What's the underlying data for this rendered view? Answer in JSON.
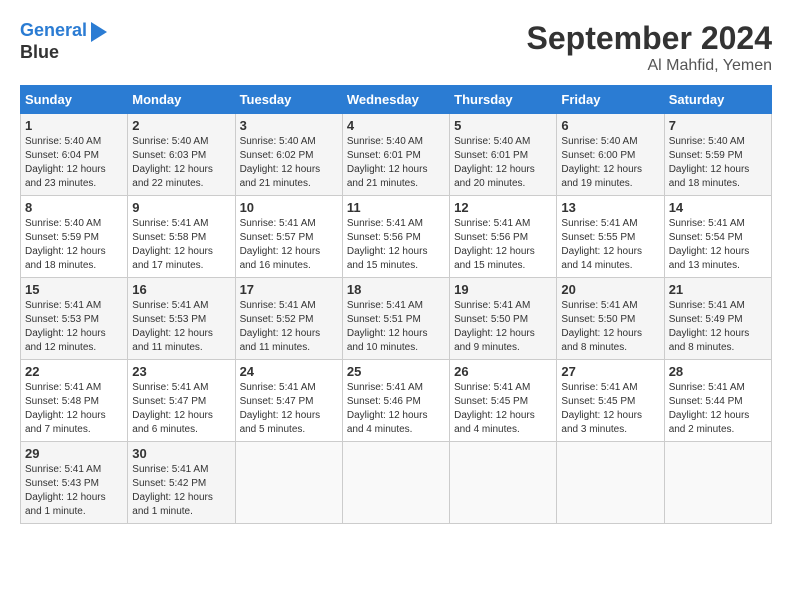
{
  "header": {
    "logo_line1": "General",
    "logo_line2": "Blue",
    "month": "September 2024",
    "location": "Al Mahfid, Yemen"
  },
  "weekdays": [
    "Sunday",
    "Monday",
    "Tuesday",
    "Wednesday",
    "Thursday",
    "Friday",
    "Saturday"
  ],
  "weeks": [
    [
      {
        "day": "1",
        "sunrise": "5:40 AM",
        "sunset": "6:04 PM",
        "daylight": "12 hours and 23 minutes."
      },
      {
        "day": "2",
        "sunrise": "5:40 AM",
        "sunset": "6:03 PM",
        "daylight": "12 hours and 22 minutes."
      },
      {
        "day": "3",
        "sunrise": "5:40 AM",
        "sunset": "6:02 PM",
        "daylight": "12 hours and 21 minutes."
      },
      {
        "day": "4",
        "sunrise": "5:40 AM",
        "sunset": "6:01 PM",
        "daylight": "12 hours and 21 minutes."
      },
      {
        "day": "5",
        "sunrise": "5:40 AM",
        "sunset": "6:01 PM",
        "daylight": "12 hours and 20 minutes."
      },
      {
        "day": "6",
        "sunrise": "5:40 AM",
        "sunset": "6:00 PM",
        "daylight": "12 hours and 19 minutes."
      },
      {
        "day": "7",
        "sunrise": "5:40 AM",
        "sunset": "5:59 PM",
        "daylight": "12 hours and 18 minutes."
      }
    ],
    [
      {
        "day": "8",
        "sunrise": "5:40 AM",
        "sunset": "5:59 PM",
        "daylight": "12 hours and 18 minutes."
      },
      {
        "day": "9",
        "sunrise": "5:41 AM",
        "sunset": "5:58 PM",
        "daylight": "12 hours and 17 minutes."
      },
      {
        "day": "10",
        "sunrise": "5:41 AM",
        "sunset": "5:57 PM",
        "daylight": "12 hours and 16 minutes."
      },
      {
        "day": "11",
        "sunrise": "5:41 AM",
        "sunset": "5:56 PM",
        "daylight": "12 hours and 15 minutes."
      },
      {
        "day": "12",
        "sunrise": "5:41 AM",
        "sunset": "5:56 PM",
        "daylight": "12 hours and 15 minutes."
      },
      {
        "day": "13",
        "sunrise": "5:41 AM",
        "sunset": "5:55 PM",
        "daylight": "12 hours and 14 minutes."
      },
      {
        "day": "14",
        "sunrise": "5:41 AM",
        "sunset": "5:54 PM",
        "daylight": "12 hours and 13 minutes."
      }
    ],
    [
      {
        "day": "15",
        "sunrise": "5:41 AM",
        "sunset": "5:53 PM",
        "daylight": "12 hours and 12 minutes."
      },
      {
        "day": "16",
        "sunrise": "5:41 AM",
        "sunset": "5:53 PM",
        "daylight": "12 hours and 11 minutes."
      },
      {
        "day": "17",
        "sunrise": "5:41 AM",
        "sunset": "5:52 PM",
        "daylight": "12 hours and 11 minutes."
      },
      {
        "day": "18",
        "sunrise": "5:41 AM",
        "sunset": "5:51 PM",
        "daylight": "12 hours and 10 minutes."
      },
      {
        "day": "19",
        "sunrise": "5:41 AM",
        "sunset": "5:50 PM",
        "daylight": "12 hours and 9 minutes."
      },
      {
        "day": "20",
        "sunrise": "5:41 AM",
        "sunset": "5:50 PM",
        "daylight": "12 hours and 8 minutes."
      },
      {
        "day": "21",
        "sunrise": "5:41 AM",
        "sunset": "5:49 PM",
        "daylight": "12 hours and 8 minutes."
      }
    ],
    [
      {
        "day": "22",
        "sunrise": "5:41 AM",
        "sunset": "5:48 PM",
        "daylight": "12 hours and 7 minutes."
      },
      {
        "day": "23",
        "sunrise": "5:41 AM",
        "sunset": "5:47 PM",
        "daylight": "12 hours and 6 minutes."
      },
      {
        "day": "24",
        "sunrise": "5:41 AM",
        "sunset": "5:47 PM",
        "daylight": "12 hours and 5 minutes."
      },
      {
        "day": "25",
        "sunrise": "5:41 AM",
        "sunset": "5:46 PM",
        "daylight": "12 hours and 4 minutes."
      },
      {
        "day": "26",
        "sunrise": "5:41 AM",
        "sunset": "5:45 PM",
        "daylight": "12 hours and 4 minutes."
      },
      {
        "day": "27",
        "sunrise": "5:41 AM",
        "sunset": "5:45 PM",
        "daylight": "12 hours and 3 minutes."
      },
      {
        "day": "28",
        "sunrise": "5:41 AM",
        "sunset": "5:44 PM",
        "daylight": "12 hours and 2 minutes."
      }
    ],
    [
      {
        "day": "29",
        "sunrise": "5:41 AM",
        "sunset": "5:43 PM",
        "daylight": "12 hours and 1 minute."
      },
      {
        "day": "30",
        "sunrise": "5:41 AM",
        "sunset": "5:42 PM",
        "daylight": "12 hours and 1 minute."
      },
      {
        "day": "",
        "sunrise": "",
        "sunset": "",
        "daylight": ""
      },
      {
        "day": "",
        "sunrise": "",
        "sunset": "",
        "daylight": ""
      },
      {
        "day": "",
        "sunrise": "",
        "sunset": "",
        "daylight": ""
      },
      {
        "day": "",
        "sunrise": "",
        "sunset": "",
        "daylight": ""
      },
      {
        "day": "",
        "sunrise": "",
        "sunset": "",
        "daylight": ""
      }
    ]
  ]
}
